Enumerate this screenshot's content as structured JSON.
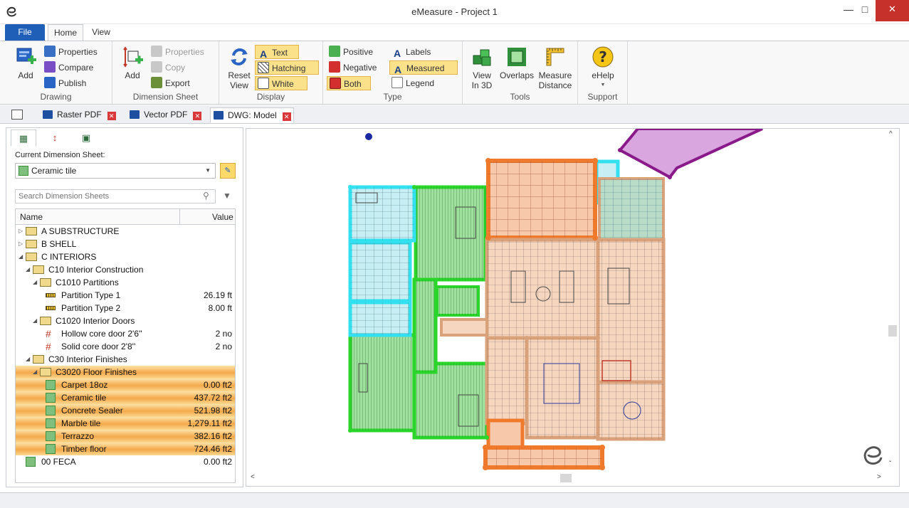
{
  "window": {
    "title": "eMeasure - Project 1"
  },
  "ribbon_tabs": {
    "file": "File",
    "home": "Home",
    "view": "View"
  },
  "ribbon": {
    "drawing": {
      "label": "Drawing",
      "add": "Add",
      "properties": "Properties",
      "compare": "Compare",
      "publish": "Publish"
    },
    "dimension_sheet": {
      "label": "Dimension Sheet",
      "add": "Add",
      "properties": "Properties",
      "copy": "Copy",
      "export": "Export"
    },
    "display": {
      "label": "Display",
      "reset_view": "Reset View",
      "text": "Text",
      "hatching": "Hatching",
      "white": "White"
    },
    "type": {
      "label": "Type",
      "positive": "Positive",
      "negative": "Negative",
      "both": "Both",
      "labels": "Labels",
      "measured": "Measured",
      "legend": "Legend"
    },
    "tools": {
      "label": "Tools",
      "view3d": "View In 3D",
      "overlaps": "Overlaps",
      "measure_distance": "Measure Distance"
    },
    "support": {
      "label": "Support",
      "ehelp": "eHelp"
    }
  },
  "doc_tabs": [
    {
      "label": "Raster PDF"
    },
    {
      "label": "Vector PDF"
    },
    {
      "label": "DWG: Model"
    }
  ],
  "panel": {
    "current_sheet_label": "Current Dimension Sheet:",
    "current_sheet": "Ceramic tile",
    "search_placeholder": "Search Dimension Sheets",
    "col_name": "Name",
    "col_value": "Value"
  },
  "tree": [
    {
      "label": "A SUBSTRUCTURE",
      "value": ""
    },
    {
      "label": "B SHELL",
      "value": ""
    },
    {
      "label": "C INTERIORS",
      "value": ""
    },
    {
      "label": "C10 Interior Construction",
      "value": ""
    },
    {
      "label": "C1010 Partitions",
      "value": ""
    },
    {
      "label": "Partition Type 1",
      "value": "26.19 ft"
    },
    {
      "label": "Partition Type 2",
      "value": "8.00 ft"
    },
    {
      "label": "C1020 Interior Doors",
      "value": ""
    },
    {
      "label": "Hollow core door 2'6''",
      "value": "2 no"
    },
    {
      "label": "Solid core door 2'8''",
      "value": "2 no"
    },
    {
      "label": "C30 Interior Finishes",
      "value": ""
    },
    {
      "label": "C3020 Floor Finishes",
      "value": ""
    },
    {
      "label": "Carpet 18oz",
      "value": "0.00 ft2"
    },
    {
      "label": "Ceramic tile",
      "value": "437.72 ft2"
    },
    {
      "label": "Concrete Sealer",
      "value": "521.98 ft2"
    },
    {
      "label": "Marble tile",
      "value": "1,279.11 ft2"
    },
    {
      "label": "Terrazzo",
      "value": "382.16 ft2"
    },
    {
      "label": "Timber floor",
      "value": "724.46 ft2"
    },
    {
      "label": "00 FECA",
      "value": "0.00 ft2"
    }
  ],
  "colors": {
    "accent": "#1f5fb7",
    "green_fill": "#8fd68f",
    "green_stroke": "#2bd62b",
    "cyan_fill": "#b8eaf0",
    "cyan_stroke": "#33e0ef",
    "orange_stroke": "#f07a2c",
    "peach_fill": "#f7c8aa",
    "tan_stroke": "#d9a27a",
    "purple": "#8a1a8a"
  },
  "icons": {
    "app": "emeasure-logo-icon",
    "close": "close-icon",
    "search": "search-icon",
    "filter": "filter-icon",
    "folder": "folder-icon",
    "measure": "measure-icon"
  }
}
